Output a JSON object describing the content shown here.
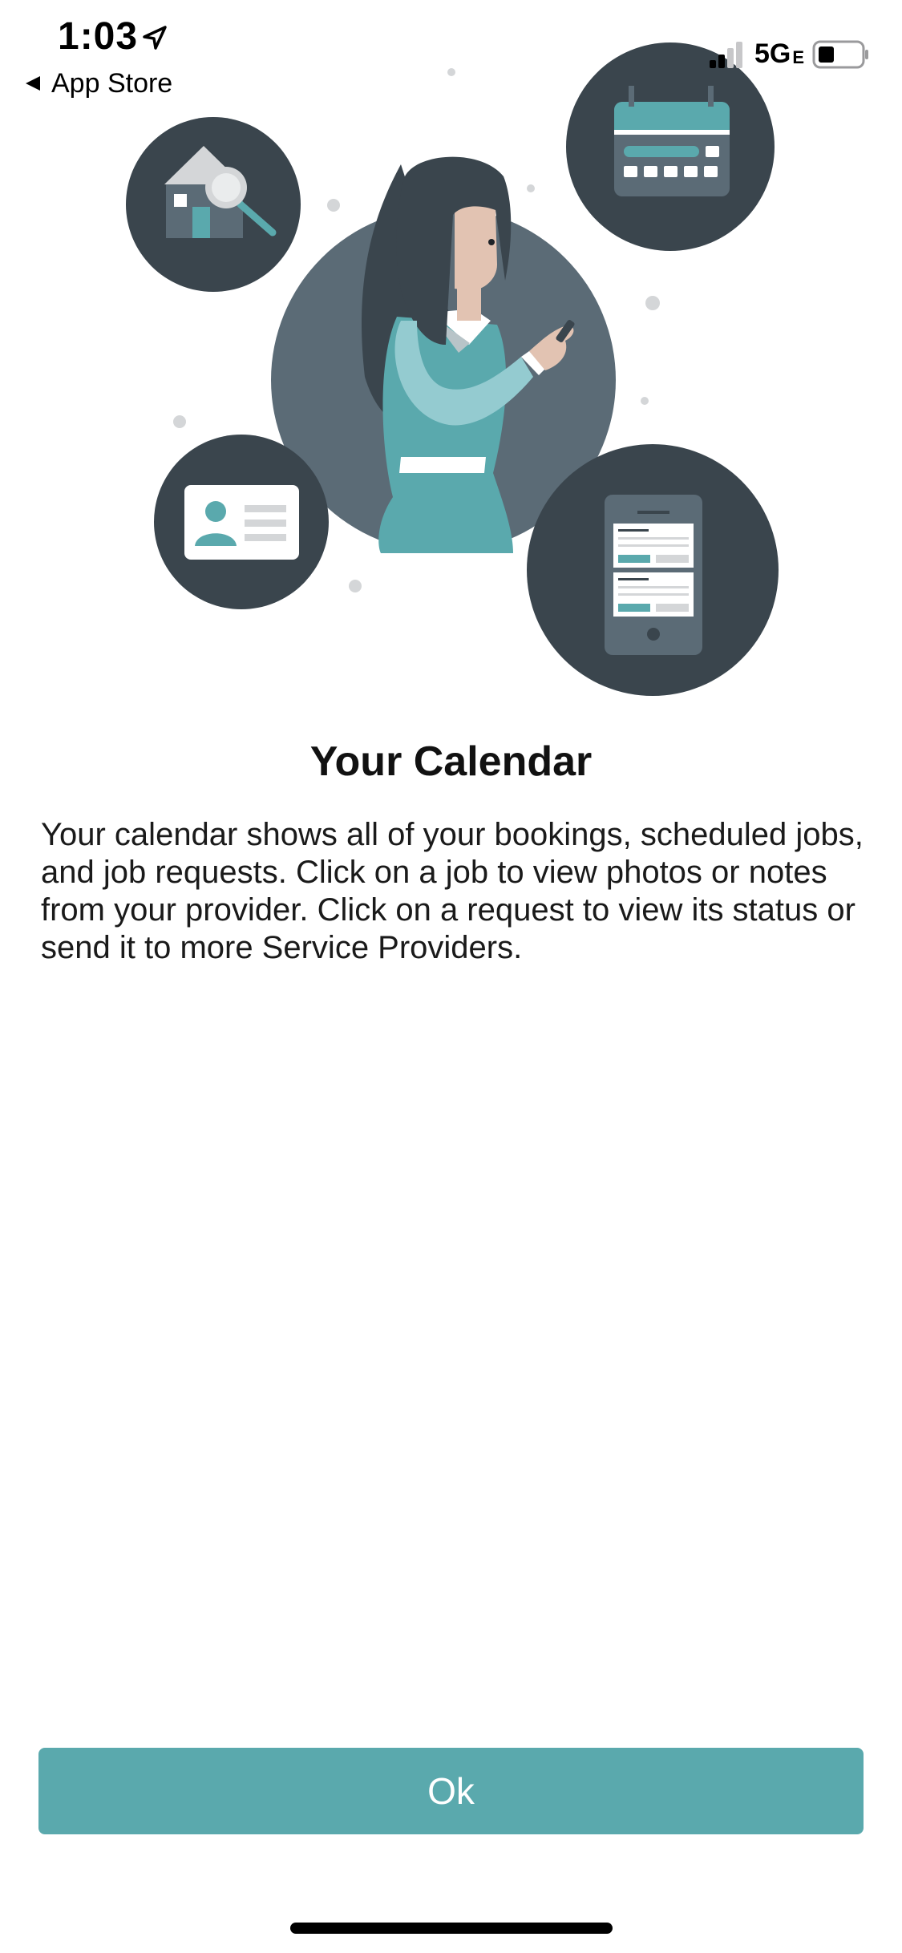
{
  "status_bar": {
    "time": "1:03",
    "back_label": "App Store",
    "network": "5G",
    "network_suffix": "E"
  },
  "onboarding": {
    "title": "Your Calendar",
    "description": "Your calendar shows all of your bookings, scheduled jobs, and job requests. Click on a job to view photos or notes from your provider. Click on a request to view its status or send it to more Service Providers.",
    "ok_label": "Ok"
  },
  "colors": {
    "accent": "#5aa9ad",
    "dark_circle": "#3a454d",
    "mid_circle": "#5b6b76"
  },
  "icons": {
    "location": "location-arrow-icon",
    "back": "back-triangle-icon",
    "signal": "cellular-signal-icon",
    "battery": "battery-icon"
  }
}
